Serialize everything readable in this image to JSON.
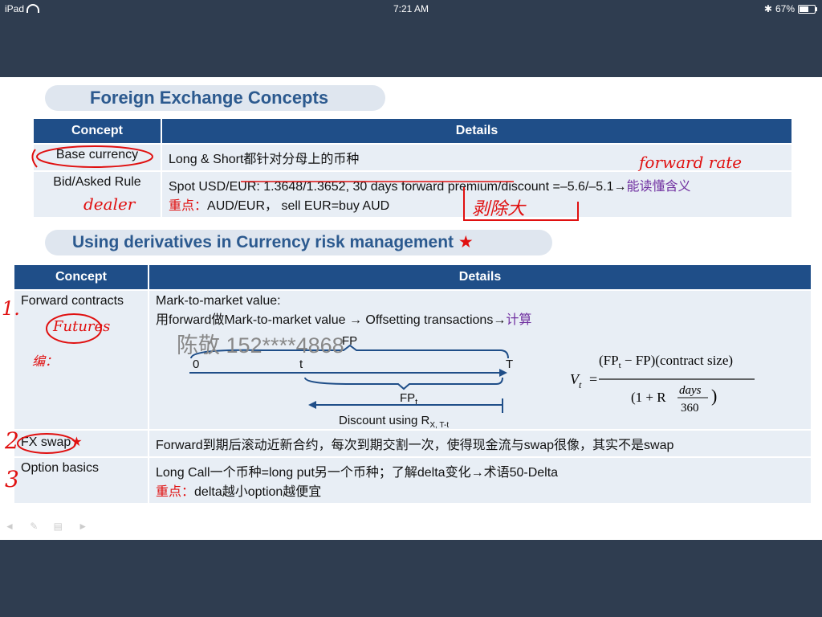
{
  "status": {
    "device": "iPad",
    "time": "7:21 AM",
    "battery": "67%"
  },
  "section1": {
    "title": "Foreign Exchange  Concepts",
    "headers": [
      "Concept",
      "Details"
    ],
    "rows": [
      {
        "concept": "Base currency",
        "details": "Long & Short都针对分母上的币种"
      },
      {
        "concept": "Bid/Asked Rule",
        "details": "Spot USD/EUR: 1.3648/1.3652, 30 days forward premium/discount =–5.6/–5.1",
        "details_tail": "能读懂含义",
        "note_label": "重点：",
        "note": "AUD/EUR，  sell EUR=buy AUD"
      }
    ]
  },
  "section2": {
    "title": "Using derivatives in Currency risk management",
    "star": "★",
    "headers": [
      "Concept",
      "Details"
    ],
    "rows": [
      {
        "concept": "Forward contracts",
        "line1": "Mark-to-market value:",
        "line2_pre": "用forward做Mark-to-market value",
        "line2_post": "Offsetting transactions",
        "line2_tail": "计算",
        "timeline": {
          "fp": "FP",
          "zero": "0",
          "t": "t",
          "T": "T",
          "fpt": "FP",
          "fpt_sub": "t",
          "discount": "Discount using R",
          "discount_sub": "X, T-t"
        }
      },
      {
        "concept": "FX swap",
        "details": "Forward到期后滚动近新合约，每次到期交割一次，使得现金流与swap很像，其实不是swap"
      },
      {
        "concept": "Option basics",
        "details": "Long Call一个币种=long put另一个币种；了解delta变化",
        "details_tail": "术语50-Delta",
        "note_label": "重点：",
        "note": "delta越小option越便宜"
      }
    ]
  },
  "formula": {
    "lhs": "V",
    "lhs_sub": "t",
    "numerator": "(FP",
    "numerator_sub": "t",
    "numerator_rest": " − FP)(contract size)",
    "denominator_pre": "(1 + R",
    "days": "days",
    "denom": "360"
  },
  "watermark": "陈敬 152****4868",
  "handwriting": {
    "forward_rate": "forward rate",
    "dealer": "dealer",
    "bid_ask": "剥除大",
    "futures": "Futures",
    "swap_note": "编：",
    "num1": "1.",
    "num2": "2",
    "num3": "3"
  },
  "arrow": "→"
}
